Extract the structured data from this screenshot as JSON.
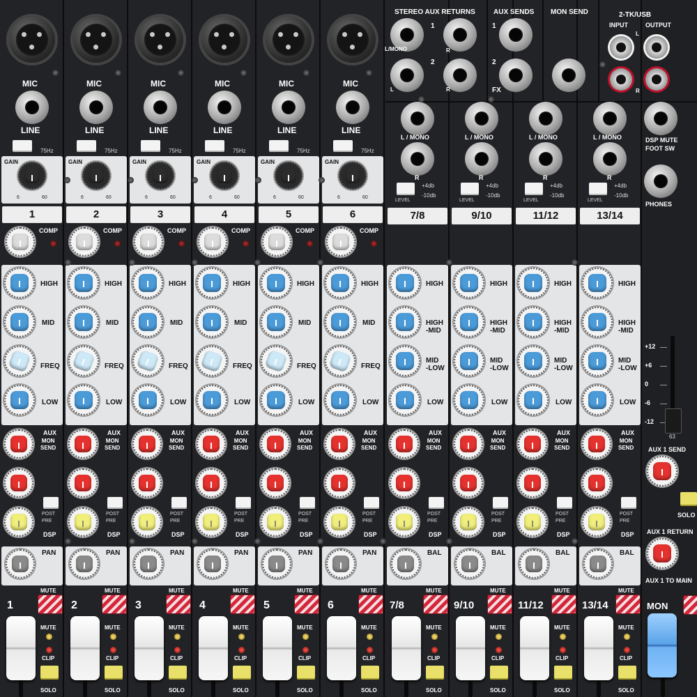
{
  "top_labels": {
    "mic": "MIC",
    "line": "LINE",
    "hpf": "75Hz",
    "gain": "GAIN",
    "gain_min": "6",
    "gain_max": "60",
    "stereo_aux_returns": "STEREO AUX RETURNS",
    "aux_sends": "AUX SENDS",
    "mon_send": "MON SEND",
    "two_tk_usb": "2-TK/USB",
    "input": "INPUT",
    "output": "OUTPUT",
    "l": "L",
    "r": "R",
    "l_mono": "L/MONO",
    "l_mono_spaced": "L / MONO",
    "fx": "FX",
    "one": "1",
    "two": "2",
    "plus4": "+4db",
    "minus10": "-10db",
    "level": "LEVEL",
    "dsp_mute": "DSP MUTE",
    "foot_sw": "FOOT SW",
    "phones": "PHONES"
  },
  "channels": [
    {
      "label": "1"
    },
    {
      "label": "2"
    },
    {
      "label": "3"
    },
    {
      "label": "4"
    },
    {
      "label": "5"
    },
    {
      "label": "6"
    }
  ],
  "stereo_channels": [
    {
      "label": "7/8"
    },
    {
      "label": "9/10"
    },
    {
      "label": "11/12"
    },
    {
      "label": "13/14"
    }
  ],
  "strip_labels": {
    "comp": "COMP",
    "high": "HIGH",
    "mid": "MID",
    "freq": "FREQ",
    "low": "LOW",
    "high_mid": "HIGH\n-MID",
    "mid_low": "MID\n-LOW",
    "aux": "AUX",
    "mon_send": "MON\nSEND",
    "post": "POST",
    "pre": "PRE",
    "dsp": "DSP",
    "pan": "PAN",
    "bal": "BAL",
    "mute": "MUTE",
    "clip": "CLIP",
    "solo": "SOLO",
    "mon": "MON"
  },
  "master": {
    "scale": [
      "+12",
      "+6",
      "0",
      "-6",
      "-12"
    ],
    "aux1_send": "AUX 1 SEND",
    "aux1_return": "AUX 1 RETURN",
    "aux1_to_main": "AUX 1 TO MAIN",
    "solo": "SOLO",
    "fader_mark": "63"
  },
  "colors": {
    "panel": "#202124",
    "light_panel": "#e4e5e7",
    "eq_knob": "#4b9bd9",
    "aux_knob": "#e5322e",
    "dsp_knob": "#f1ef7a",
    "pan_knob": "#8a8a8a",
    "comp_knob": "#dcdcdc",
    "mute_red": "#d3283b"
  }
}
